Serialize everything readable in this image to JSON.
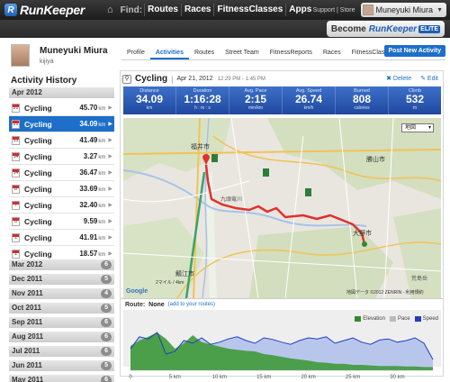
{
  "topbar": {
    "logo_text": "RunKeeper",
    "home_icon": "home-icon",
    "find_label": "Find:",
    "nav": [
      "Routes",
      "Races",
      "FitnessClasses",
      "Apps"
    ],
    "support": "Support | Store",
    "user_name": "Muneyuki Miura"
  },
  "elite": {
    "become": "Become",
    "brand": "RunKeeper",
    "badge": "ELITE"
  },
  "profile": {
    "name": "Muneyuki Miura",
    "location": "kijiya",
    "tabs": [
      "Profile",
      "Activities",
      "Routes",
      "Street Team",
      "FitnessReports",
      "Races",
      "FitnessClasses"
    ],
    "active_tab": "Activities",
    "post_button": "Post New Activity"
  },
  "sidebar": {
    "title": "Activity History",
    "current_month": "Apr 2012",
    "activities": [
      {
        "day": "21",
        "name": "Cycling",
        "dist": "45.70",
        "unit": "km",
        "selected": false
      },
      {
        "day": "21",
        "name": "Cycling",
        "dist": "34.09",
        "unit": "km",
        "selected": true
      },
      {
        "day": "15",
        "name": "Cycling",
        "dist": "41.49",
        "unit": "km",
        "selected": false
      },
      {
        "day": "14",
        "name": "Cycling",
        "dist": "3.27",
        "unit": "km",
        "selected": false
      },
      {
        "day": "14",
        "name": "Cycling",
        "dist": "36.47",
        "unit": "km",
        "selected": false
      },
      {
        "day": "8",
        "name": "Cycling",
        "dist": "33.69",
        "unit": "km",
        "selected": false
      },
      {
        "day": "7",
        "name": "Cycling",
        "dist": "32.40",
        "unit": "km",
        "selected": false
      },
      {
        "day": "6",
        "name": "Cycling",
        "dist": "9.59",
        "unit": "km",
        "selected": false
      },
      {
        "day": "1",
        "name": "Cycling",
        "dist": "41.91",
        "unit": "km",
        "selected": false
      },
      {
        "day": "1",
        "name": "Cycling",
        "dist": "18.57",
        "unit": "km",
        "selected": false
      }
    ],
    "months": [
      {
        "label": "Mar 2012",
        "count": "6"
      },
      {
        "label": "Dec 2011",
        "count": "5"
      },
      {
        "label": "Nov 2011",
        "count": "4"
      },
      {
        "label": "Oct 2011",
        "count": "5"
      },
      {
        "label": "Sep 2011",
        "count": "6"
      },
      {
        "label": "Aug 2011",
        "count": "6"
      },
      {
        "label": "Jul 2011",
        "count": "6"
      },
      {
        "label": "Jun 2011",
        "count": "5"
      },
      {
        "label": "May 2011",
        "count": "6"
      }
    ]
  },
  "activity": {
    "type": "Cycling",
    "date": "Apr 21, 2012",
    "time": "12:29 PM - 1:45 PM",
    "delete": "✖ Delete",
    "edit": "✎ Edit",
    "stats": [
      {
        "label": "Distance",
        "value": "34.09",
        "unit": "km"
      },
      {
        "label": "Duration",
        "value": "1:16:28",
        "unit": "h : m : s"
      },
      {
        "label": "Avg. Pace",
        "value": "2:15",
        "unit": "min/km"
      },
      {
        "label": "Avg. Speed",
        "value": "26.74",
        "unit": "km/h"
      },
      {
        "label": "Burned",
        "value": "808",
        "unit": "calories"
      },
      {
        "label": "Climb",
        "value": "532",
        "unit": "m"
      }
    ],
    "map": {
      "type_select": "地図",
      "labels": [
        "福井市",
        "勝山市",
        "大野市",
        "鯖江市",
        "九頭竜川",
        "荒島岳"
      ],
      "copyright": "地図データ ©2012 ZENRIN - 利用規約",
      "scale": "2マイル / 4km",
      "google": "Google"
    },
    "route_label": "Route:",
    "route_value": "None",
    "route_add": "(add to your routes)"
  },
  "chart_data": {
    "type": "area",
    "legend": [
      {
        "name": "Elevation",
        "color": "#2f8a2f"
      },
      {
        "name": "Pace",
        "color": "#bbbbbb"
      },
      {
        "name": "Speed",
        "color": "#1f3fbf"
      }
    ],
    "x_ticks": [
      "0",
      "5 km",
      "10 km",
      "15 km",
      "20 km",
      "25 km",
      "30 km"
    ],
    "x_km": [
      0,
      1,
      2,
      3,
      4,
      5,
      6,
      7,
      8,
      9,
      10,
      11,
      12,
      13,
      14,
      15,
      16,
      17,
      18,
      19,
      20,
      21,
      22,
      23,
      24,
      25,
      26,
      27,
      28,
      29,
      30,
      31,
      32,
      33,
      34
    ],
    "elevation": [
      45,
      55,
      62,
      70,
      58,
      40,
      50,
      65,
      52,
      48,
      44,
      40,
      38,
      36,
      35,
      30,
      28,
      25,
      22,
      20,
      18,
      15,
      14,
      12,
      12,
      10,
      10,
      9,
      8,
      8,
      8,
      7,
      7,
      6,
      6
    ],
    "speed": [
      40,
      62,
      58,
      70,
      30,
      35,
      55,
      50,
      60,
      48,
      52,
      58,
      62,
      55,
      50,
      60,
      57,
      52,
      48,
      55,
      60,
      58,
      62,
      50,
      55,
      60,
      52,
      48,
      56,
      58,
      52,
      55,
      60,
      50,
      20
    ]
  }
}
